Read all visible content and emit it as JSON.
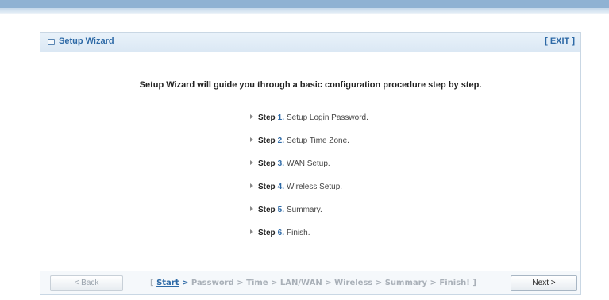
{
  "wizard": {
    "title": "Setup Wizard",
    "exit_label": "[ EXIT ]",
    "intro": "Setup Wizard will guide you through a basic configuration procedure step by step.",
    "steps": [
      {
        "word": "Step",
        "number": "1.",
        "text": "Setup Login Password."
      },
      {
        "word": "Step",
        "number": "2.",
        "text": "Setup Time Zone."
      },
      {
        "word": "Step",
        "number": "3.",
        "text": "WAN Setup."
      },
      {
        "word": "Step",
        "number": "4.",
        "text": "Wireless Setup."
      },
      {
        "word": "Step",
        "number": "5.",
        "text": "Summary."
      },
      {
        "word": "Step",
        "number": "6.",
        "text": "Finish."
      }
    ]
  },
  "footer": {
    "back_label": "< Back",
    "next_label": "Next >",
    "breadcrumb": {
      "open": "[",
      "current": "Start",
      "first_sep": ">",
      "rest": "Password > Time > LAN/WAN > Wireless > Summary > Finish! ]"
    }
  },
  "colors": {
    "accent": "#2d69a6",
    "top_bar": "#8fb2d3",
    "header_bg": "#e3eef8",
    "border": "#c9d7e4"
  }
}
